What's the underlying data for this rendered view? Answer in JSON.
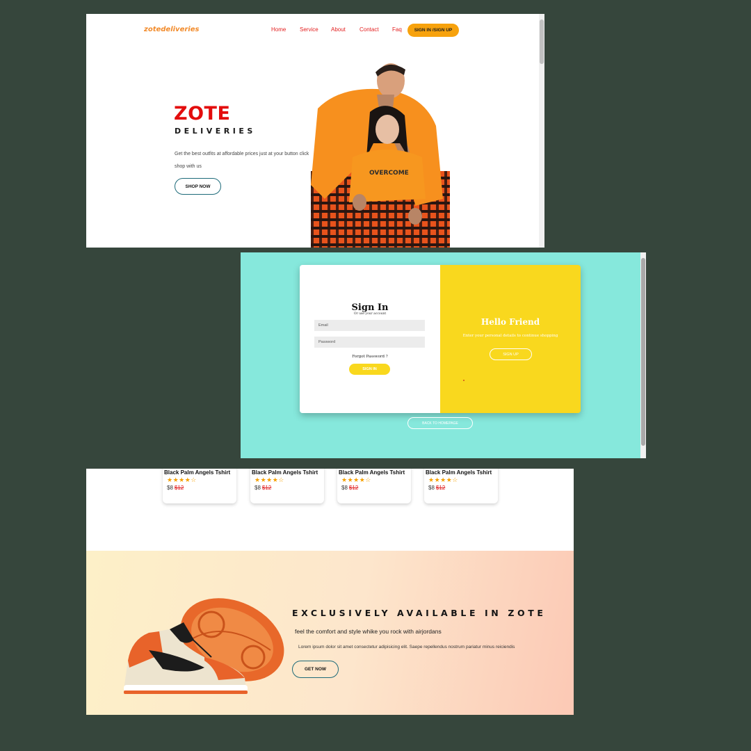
{
  "homepage": {
    "logo": "zotedeliveries",
    "nav": [
      "Home",
      "Service",
      "About",
      "Contact",
      "Faq"
    ],
    "signin_signup": "SIGN IN /SIGN UP",
    "hero_title": "ZOTE",
    "hero_subtitle": "DELIVERIES",
    "hero_description": "Get the best outfits at affordable prices just at your button click shop with us",
    "shop_button": "SHOP NOW",
    "hero_graphic_text": "OVERCOME"
  },
  "signin_page": {
    "title": "Sign In",
    "subtitle": "Or use your account",
    "email_placeholder": "Email",
    "password_placeholder": "Password",
    "forgot": "Forgot Password ?",
    "signin_button": "SIGN IN",
    "hello_title": "Hello Friend",
    "hello_text": "Enter your personal details to continue shopping",
    "signup_button": "SIGN UP",
    "back_button": "BACK TO HOMEPAGE"
  },
  "products": [
    {
      "name": "Black Palm Angels Tshirt",
      "stars": "★★★★☆",
      "price": "$8",
      "old_price": "$12"
    },
    {
      "name": "Black Palm Angels Tshirt",
      "stars": "★★★★☆",
      "price": "$8",
      "old_price": "$12"
    },
    {
      "name": "Black Palm Angels Tshirt",
      "stars": "★★★★☆",
      "price": "$8",
      "old_price": "$12"
    },
    {
      "name": "Black Palm Angels Tshirt",
      "stars": "★★★★☆",
      "price": "$8",
      "old_price": "$12"
    }
  ],
  "banner": {
    "title": "EXCLUSIVELY AVAILABLE IN ZOTE",
    "subtitle": "feel the comfort and style whike you rock with airjordans",
    "description": "Lorem ipsum dolor sit amet consectetur adipisicing elit. Saepe repellendus nostrum pariatur minus reiciendis",
    "button": "GET NOW"
  },
  "colors": {
    "background": "#36463c",
    "accent_orange": "#f7a20d",
    "brand_red": "#e30d0d",
    "signin_bg": "#86e8dc",
    "signin_yellow": "#f9d81e",
    "button_border": "#1c6a79"
  }
}
